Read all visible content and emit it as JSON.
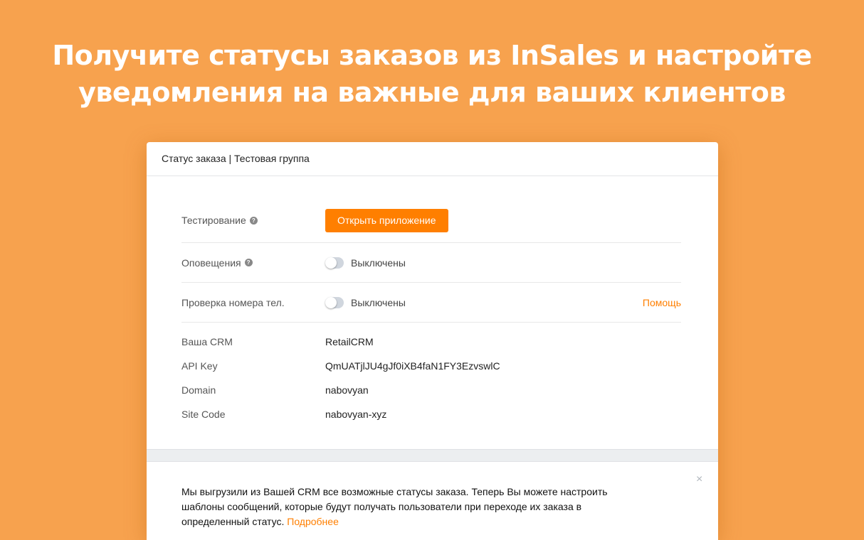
{
  "hero": {
    "line1": "Получите статусы заказов из InSales и настройте",
    "line2": "уведомления на важные для ваших клиентов"
  },
  "card": {
    "title": "Статус заказа | Тестовая группа"
  },
  "settings": {
    "testing": {
      "label": "Тестирование",
      "button": "Открыть приложение"
    },
    "notifications": {
      "label": "Оповещения",
      "state": "Выключены",
      "enabled": false
    },
    "phone_check": {
      "label": "Проверка номера тел.",
      "state": "Выключены",
      "enabled": false,
      "help_link": "Помощь"
    }
  },
  "info": [
    {
      "key": "Ваша CRM",
      "value": "RetailCRM"
    },
    {
      "key": "API Key",
      "value": "QmUATjlJU4gJf0iXB4faN1FY3EzvswlC"
    },
    {
      "key": "Domain",
      "value": "nabovyan"
    },
    {
      "key": "Site Code",
      "value": "nabovyan-xyz"
    }
  ],
  "notice": {
    "text": "Мы выгрузили из Вашей CRM все возможные статусы заказа. Теперь Вы можете настроить шаблоны сообщений, которые будут получать пользователи при переходе их заказа в определенный статус.",
    "link": "Подробнее",
    "close": "×"
  },
  "colors": {
    "background": "#F7A24E",
    "accent": "#FF7F00"
  }
}
